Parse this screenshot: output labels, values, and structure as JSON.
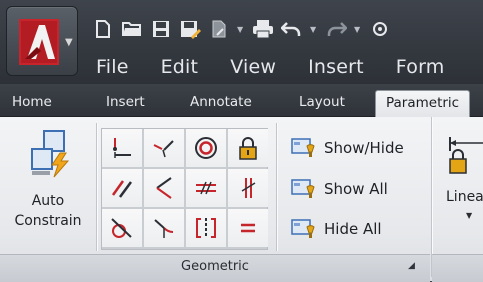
{
  "quick_access": {
    "icons": [
      "new-file-icon",
      "open-folder-icon",
      "save-icon",
      "save-as-icon",
      "plot-icon",
      "print-icon",
      "undo-icon",
      "redo-icon"
    ]
  },
  "menu": {
    "items": [
      "File",
      "Edit",
      "View",
      "Insert",
      "Form"
    ]
  },
  "tabs": {
    "items": [
      "Home",
      "Insert",
      "Annotate",
      "Layout",
      "Parametric"
    ],
    "active": "Parametric"
  },
  "auto_constrain": {
    "line1": "Auto",
    "line2": "Constrain"
  },
  "geometric_grid": {
    "icons": [
      "coincident-icon",
      "collinear-icon",
      "concentric-icon",
      "fix-icon",
      "parallel-icon",
      "perpendicular-icon",
      "horizontal-icon",
      "vertical-icon",
      "tangent-icon",
      "smooth-icon",
      "symmetric-icon",
      "equal-icon"
    ]
  },
  "show_hide": {
    "show_hide": "Show/Hide",
    "show_all": "Show All",
    "hide_all": "Hide All"
  },
  "panel": {
    "label": "Geometric"
  },
  "linear": {
    "label": "Linea"
  },
  "colors": {
    "accent_red": "#c8242b",
    "constraint_red": "#c5252b",
    "lock_gold": "#e3a416"
  }
}
